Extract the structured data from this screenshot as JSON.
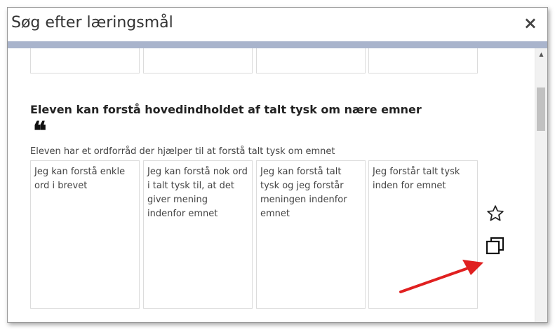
{
  "dialog": {
    "title": "Søg efter læringsmål",
    "close_symbol": "×"
  },
  "section": {
    "title": "Eleven kan forstå hovedindholdet af talt tysk om nære emner",
    "quote_mark": "❝",
    "description": "Eleven har et ordforråd der hjælper til at forstå talt tysk om emnet",
    "levels": [
      {
        "text": "Jeg kan forstå enkle ord i brevet"
      },
      {
        "text": "Jeg kan forstå nok ord i talt tysk til, at det giver mening indenfor emnet"
      },
      {
        "text": "Jeg kan forstå talt tysk  og jeg forstår meningen indenfor emnet"
      },
      {
        "text": "Jeg forstår talt tysk inden for emnet"
      }
    ]
  },
  "icons": {
    "favorite": "star-icon",
    "copy": "copy-icon",
    "annotation": "red-arrow"
  },
  "colors": {
    "accent_bar": "#a9b4cc",
    "annotation_arrow": "#e02020"
  }
}
